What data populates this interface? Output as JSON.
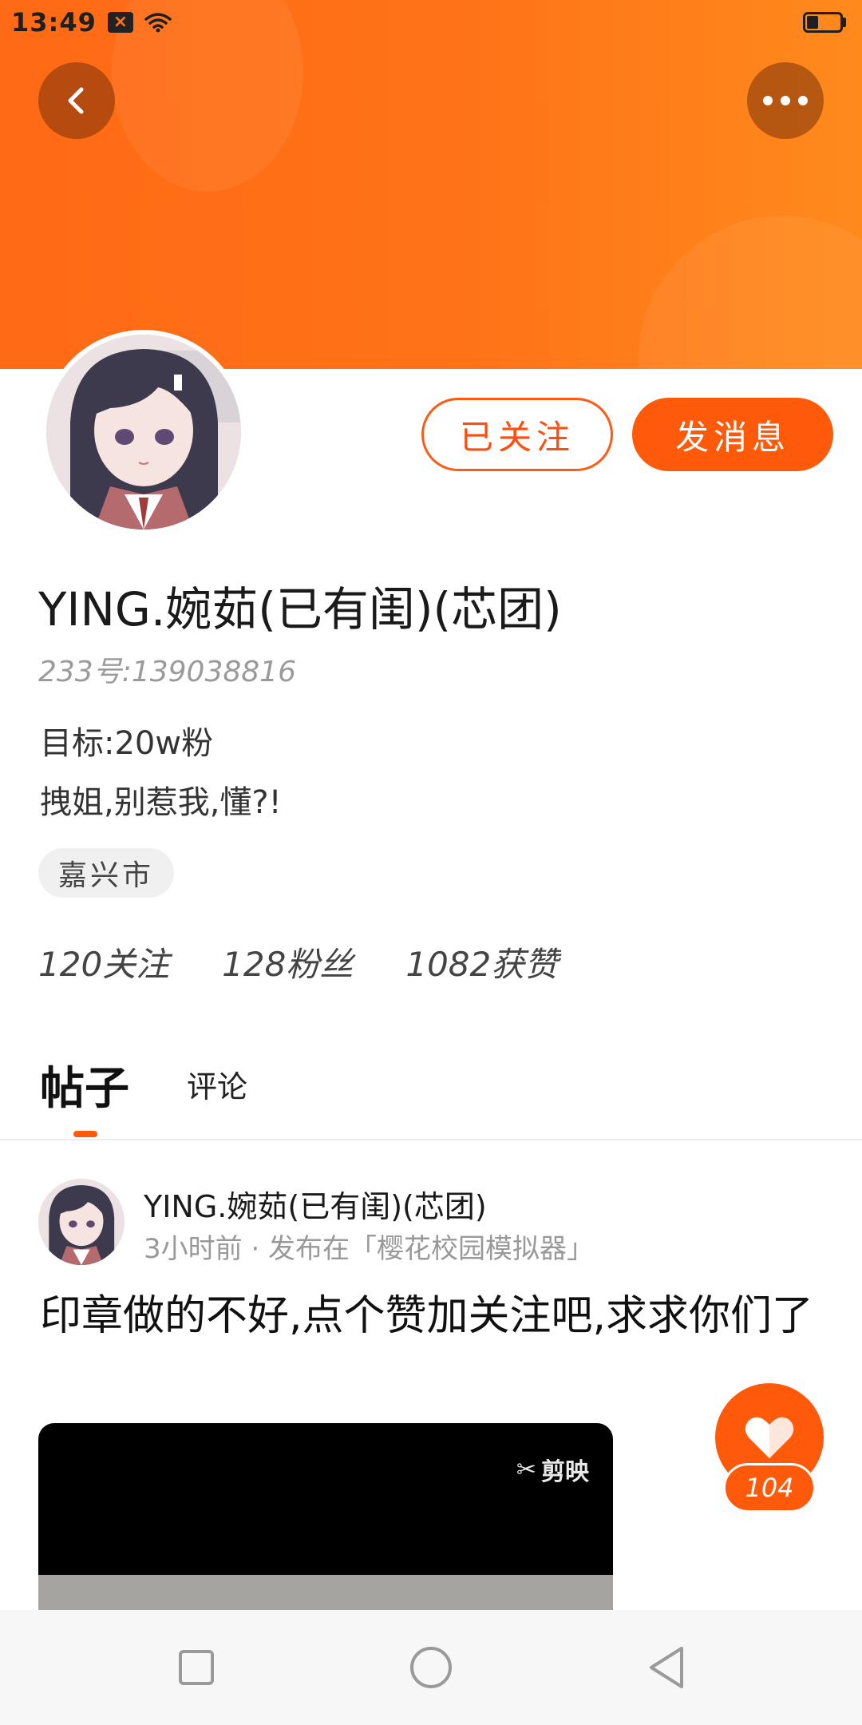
{
  "status_bar": {
    "time": "13:49",
    "notification_icon": "mail-x-icon",
    "wifi_icon": "wifi-icon",
    "battery_icon": "battery-icon"
  },
  "header": {
    "back_icon": "chevron-left-icon",
    "more_icon": "more-dots-icon",
    "accent_color": "#ff6a14"
  },
  "profile": {
    "follow_label": "已关注",
    "message_label": "发消息",
    "nickname": "YING.婉茹(已有闺)(芯团)",
    "user_id": "233号:139038816",
    "bio_line1": "目标:20w粉",
    "bio_line2": "拽姐,别惹我,懂?!",
    "location": "嘉兴市",
    "stats": {
      "following": "120关注",
      "fans": "128粉丝",
      "likes": "1082获赞"
    }
  },
  "tabs": {
    "posts": "帖子",
    "comments": "评论"
  },
  "post": {
    "author": "YING.婉茹(已有闺)(芯团)",
    "meta": "3小时前 · 发布在「樱花校园模拟器」",
    "text": "印章做的不好,点个赞加关注吧,求求你们了",
    "watermark": "剪映"
  },
  "like": {
    "icon": "heart-icon",
    "count": "104"
  },
  "nav": {
    "square_icon": "recent-apps-icon",
    "circle_icon": "home-icon",
    "back_icon": "triangle-back-icon"
  }
}
